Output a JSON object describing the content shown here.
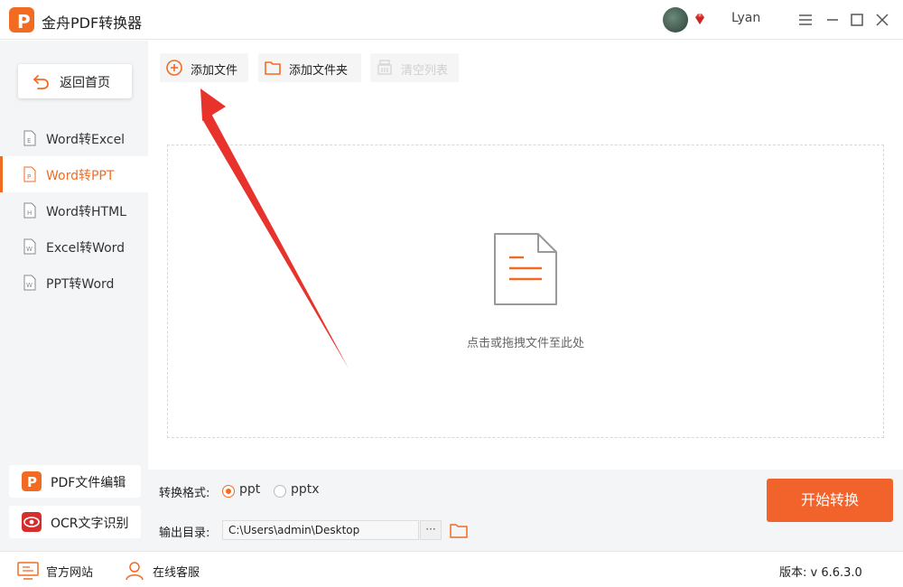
{
  "app": {
    "title": "金舟PDF转换器",
    "logo_letter": "P",
    "username": "Lyan",
    "brand_color": "#f26b22"
  },
  "sidebar": {
    "back_label": "返回首页",
    "items": [
      {
        "label": "Word转Excel",
        "icon_letter": "E",
        "active": false
      },
      {
        "label": "Word转PPT",
        "icon_letter": "P",
        "active": true
      },
      {
        "label": "Word转HTML",
        "icon_letter": "H",
        "active": false
      },
      {
        "label": "Excel转Word",
        "icon_letter": "W",
        "active": false
      },
      {
        "label": "PPT转Word",
        "icon_letter": "W",
        "active": false
      }
    ],
    "tools": [
      {
        "label": "PDF文件编辑",
        "icon": "pdf-edit-icon"
      },
      {
        "label": "OCR文字识别",
        "icon": "ocr-eye-icon"
      }
    ]
  },
  "toolbar": {
    "add_file": "添加文件",
    "add_folder": "添加文件夹",
    "clear_list": "清空列表"
  },
  "dropzone": {
    "hint": "点击或拖拽文件至此处"
  },
  "options": {
    "format_label": "转换格式:",
    "formats": [
      {
        "label": "ppt",
        "checked": true
      },
      {
        "label": "pptx",
        "checked": false
      }
    ],
    "output_label": "输出目录:",
    "output_path": "C:\\Users\\admin\\Desktop",
    "more": "···",
    "start_label": "开始转换"
  },
  "statusbar": {
    "website": "官方网站",
    "support": "在线客服",
    "version": "版本: v 6.6.3.0"
  }
}
